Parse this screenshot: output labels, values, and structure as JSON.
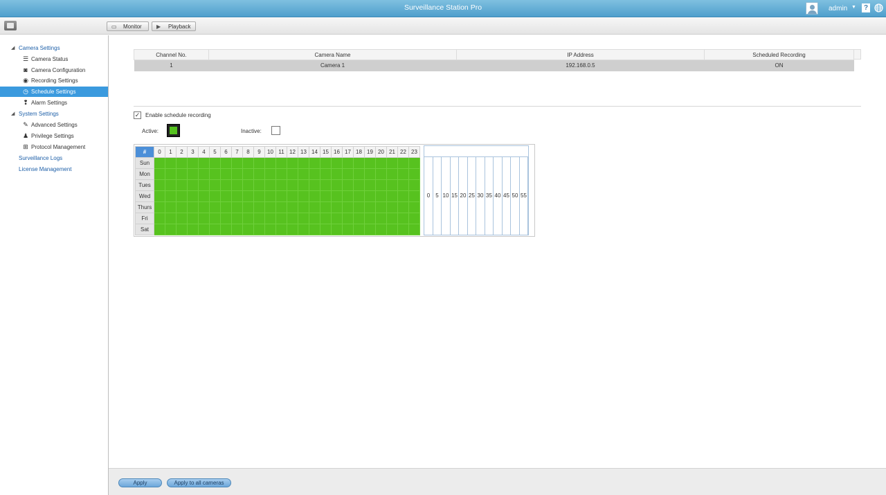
{
  "titlebar": {
    "app_title": "Surveillance Station Pro",
    "user": "admin"
  },
  "toolbar": {
    "monitor_label": "Monitor",
    "playback_label": "Playback"
  },
  "sidebar": {
    "camera_settings": "Camera Settings",
    "camera_items": [
      {
        "label": "Camera Status",
        "icon": "camera-status-icon"
      },
      {
        "label": "Camera Configuration",
        "icon": "camera-config-icon"
      },
      {
        "label": "Recording Settings",
        "icon": "record-icon"
      },
      {
        "label": "Schedule Settings",
        "icon": "clock-icon",
        "selected": true
      },
      {
        "label": "Alarm Settings",
        "icon": "alarm-icon"
      }
    ],
    "system_settings": "System Settings",
    "system_items": [
      {
        "label": "Advanced Settings",
        "icon": "wrench-icon"
      },
      {
        "label": "Privilege Settings",
        "icon": "user-icon"
      },
      {
        "label": "Protocol Management",
        "icon": "network-icon"
      }
    ],
    "surveillance_logs": "Surveillance Logs",
    "license_management": "License Management"
  },
  "camera_table": {
    "columns": [
      "Channel No.",
      "Camera Name",
      "IP Address",
      "Scheduled Recording"
    ],
    "rows": [
      [
        "1",
        "Camera 1",
        "192.168.0.5",
        "ON"
      ]
    ]
  },
  "schedule": {
    "enable_label": "Enable schedule recording",
    "enabled": true,
    "active_label": "Active:",
    "inactive_label": "Inactive:",
    "active_color": "#57c21f",
    "corner": "#",
    "hours": [
      "0",
      "1",
      "2",
      "3",
      "4",
      "5",
      "6",
      "7",
      "8",
      "9",
      "10",
      "11",
      "12",
      "13",
      "14",
      "15",
      "16",
      "17",
      "18",
      "19",
      "20",
      "21",
      "22",
      "23"
    ],
    "days": [
      "Sun",
      "Mon",
      "Tues",
      "Wed",
      "Thurs",
      "Fri",
      "Sat"
    ],
    "minutes": [
      "0",
      "5",
      "10",
      "15",
      "20",
      "25",
      "30",
      "35",
      "40",
      "45",
      "50",
      "55"
    ]
  },
  "footer": {
    "apply_label": "Apply",
    "apply_all_label": "Apply to all cameras"
  }
}
